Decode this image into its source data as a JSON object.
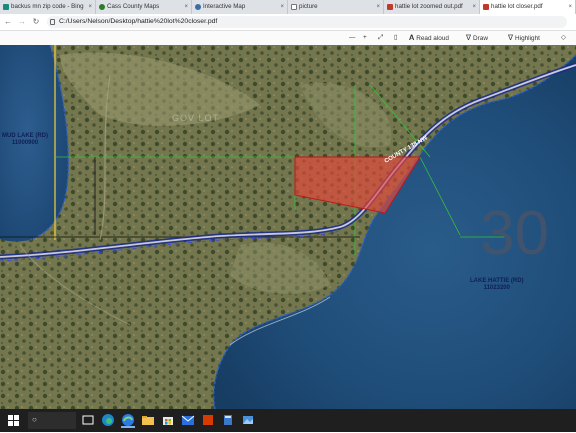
{
  "browser": {
    "tabs": [
      {
        "title": "backus mn zip code - Bing",
        "icon_color": "#1b8a7a"
      },
      {
        "title": "Cass County Maps",
        "icon_color": "#2d7a2d"
      },
      {
        "title": "Interactive Map",
        "icon_color": "#3a6ea5"
      },
      {
        "title": "picture",
        "icon_color": "#6b6b6b"
      },
      {
        "title": "hattie lot zoomed out.pdf",
        "icon_color": "#c0392b"
      },
      {
        "title": "hattie lot closer.pdf",
        "icon_color": "#c0392b",
        "active": true
      }
    ],
    "close_glyph": "×",
    "url": "C:/Users/Nelson/Desktop/hattie%20lot%20closer.pdf"
  },
  "pdf_toolbar": {
    "minus": "—",
    "plus": "+",
    "fit": "⤢",
    "page_view": "▯",
    "read_aloud_label": "Read aloud",
    "draw_label": "Draw",
    "highlight_label": "Highlight",
    "erase": "◇",
    "draw_symbol": "∇",
    "highlight_symbol": "∇"
  },
  "map": {
    "mud_lake_label": "MUD LAKE (RD)",
    "mud_lake_id": "11000900",
    "hattie_label": "LAKE HATTIE (RD)",
    "hattie_id": "11023200",
    "section_number": "30",
    "road_name": "COUNTY 138 NW",
    "gov_lot": "GOV LOT",
    "parcel_color": "#e8473a",
    "water_color": "#1c4a73"
  },
  "taskbar": {
    "search_glyph": "○"
  }
}
